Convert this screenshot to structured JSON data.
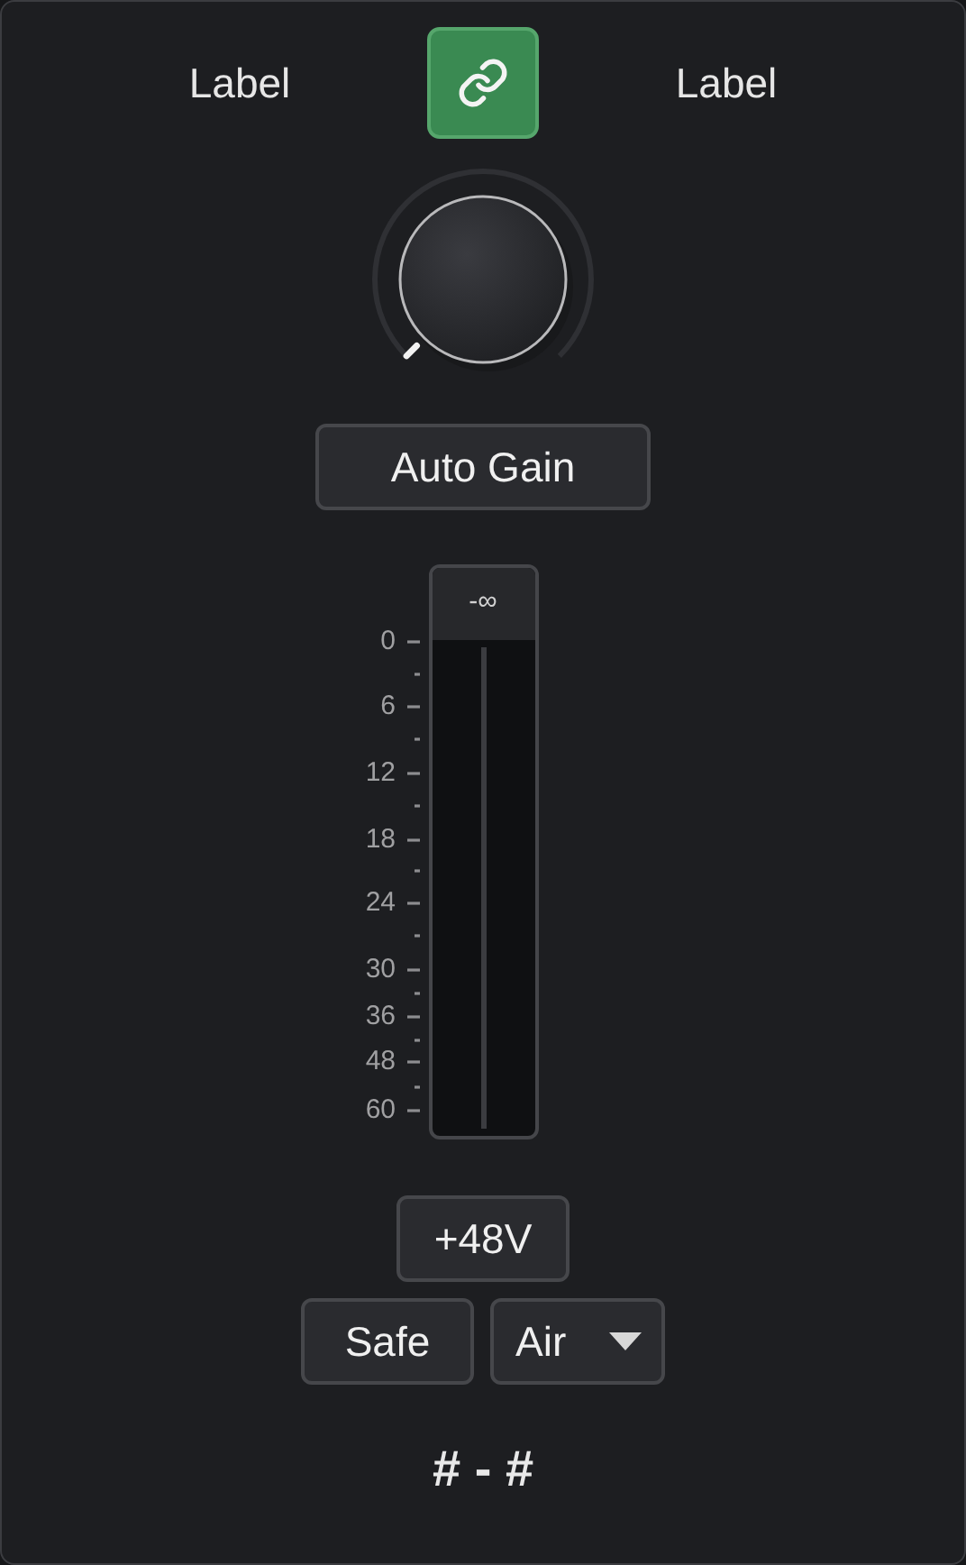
{
  "header": {
    "left_label": "Label",
    "right_label": "Label",
    "link": {
      "on": true
    }
  },
  "auto_gain": {
    "label": "Auto Gain",
    "on": false
  },
  "meter": {
    "peak_reading": "-∞",
    "scale": [
      "0",
      "6",
      "12",
      "18",
      "24",
      "30",
      "36",
      "48",
      "60"
    ]
  },
  "phantom_power": {
    "label": "+48V",
    "on": false
  },
  "safe": {
    "label": "Safe",
    "on": false
  },
  "air": {
    "label": "Air"
  },
  "channel_number": "# - #"
}
